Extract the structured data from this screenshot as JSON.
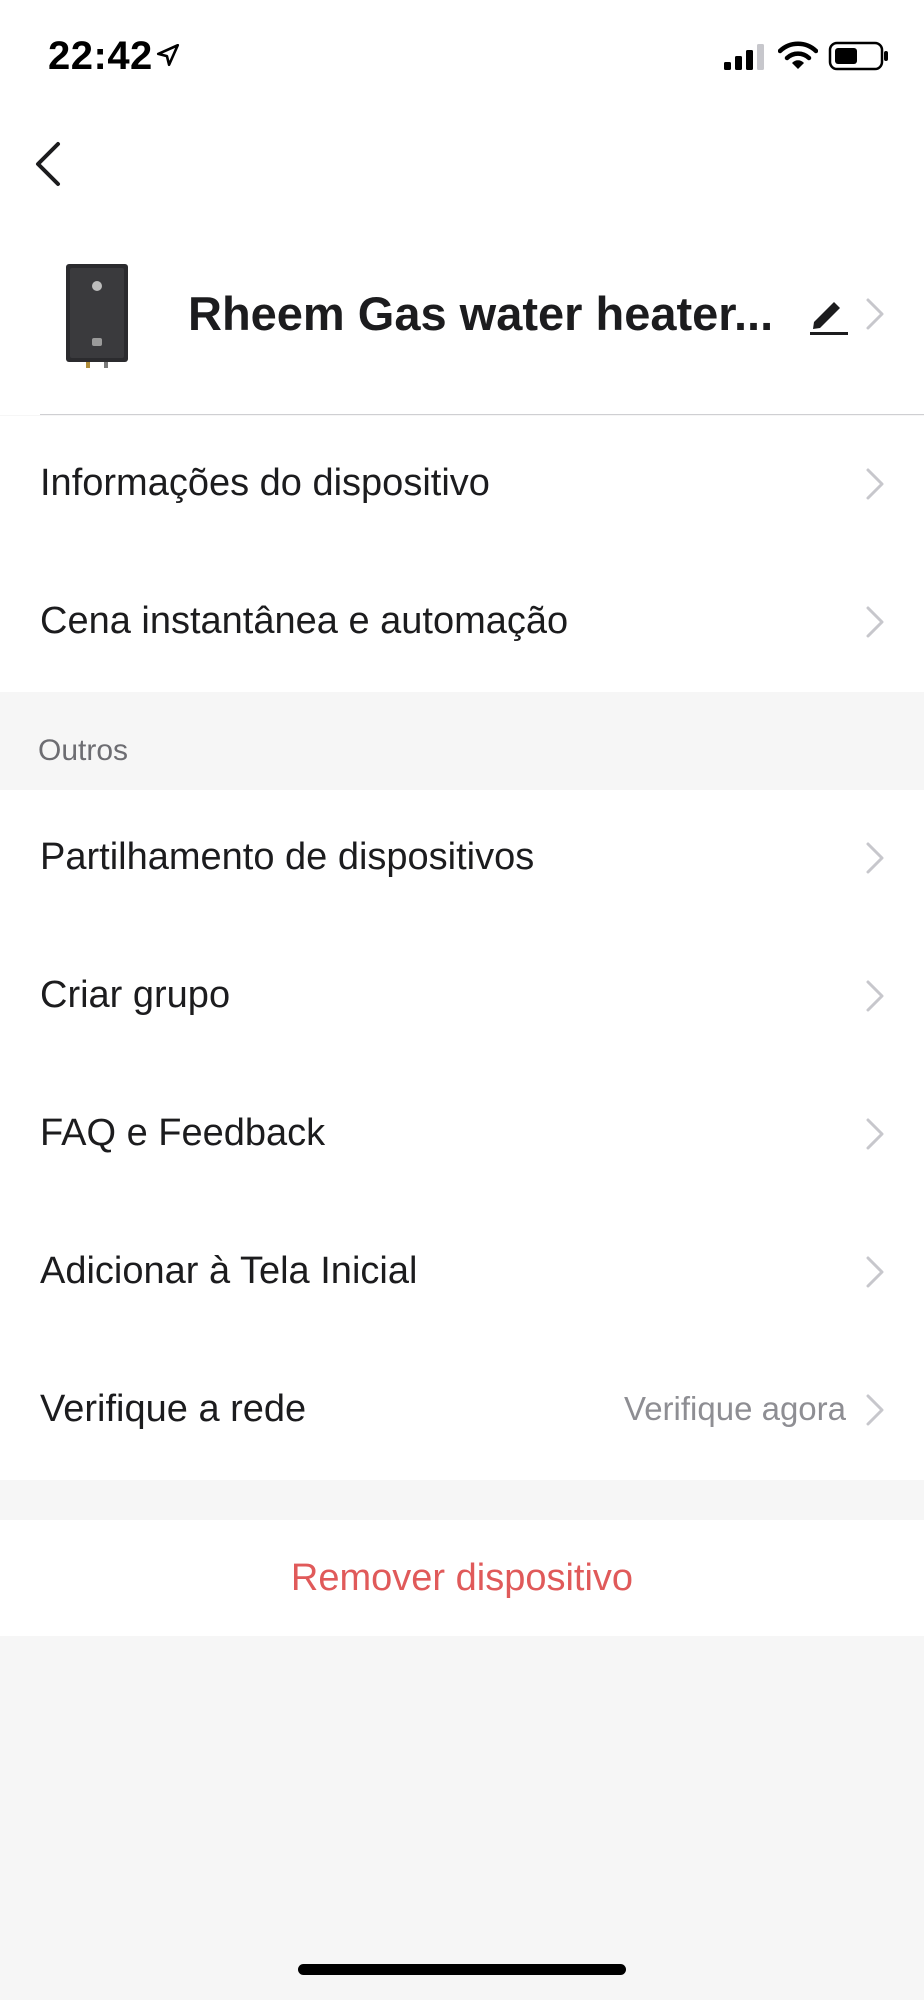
{
  "status_bar": {
    "time": "22:42"
  },
  "device": {
    "name": "Rheem Gas water heater..."
  },
  "section_main": {
    "items": [
      {
        "label": "Informações do dispositivo"
      },
      {
        "label": "Cena instantânea e automação"
      }
    ]
  },
  "section_other": {
    "title": "Outros",
    "items": [
      {
        "label": "Partilhamento de dispositivos"
      },
      {
        "label": "Criar grupo"
      },
      {
        "label": "FAQ e Feedback"
      },
      {
        "label": "Adicionar à Tela Inicial"
      },
      {
        "label": "Verifique a rede",
        "value": "Verifique agora"
      }
    ]
  },
  "remove_label": "Remover dispositivo",
  "icons": {
    "location": "location-arrow-icon",
    "signal": "cellular-signal-icon",
    "wifi": "wifi-icon",
    "battery": "battery-icon",
    "back": "chevron-left-icon",
    "edit": "pencil-icon",
    "chevron": "chevron-right-icon"
  },
  "colors": {
    "destructive": "#e05a5a",
    "background": "#f6f6f6",
    "secondary_text": "#8e8e93"
  }
}
